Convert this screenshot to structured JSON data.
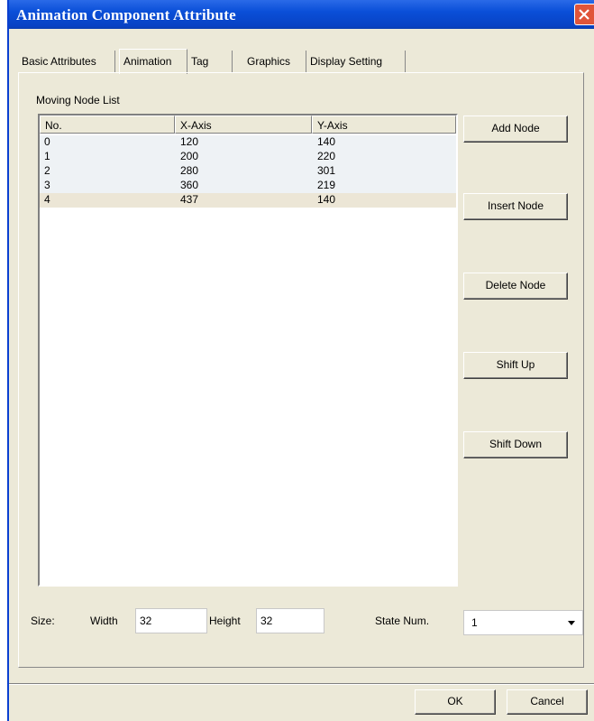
{
  "window": {
    "title": "Animation Component Attribute"
  },
  "tabs": [
    "Basic Attributes",
    "Animation",
    "Tag",
    "Graphics",
    "Display Setting"
  ],
  "active_tab": "Animation",
  "moving_node_list": {
    "label": "Moving Node List",
    "columns": [
      "No.",
      "X-Axis",
      "Y-Axis"
    ],
    "rows": [
      [
        "0",
        "120",
        "140"
      ],
      [
        "1",
        "200",
        "220"
      ],
      [
        "2",
        "280",
        "301"
      ],
      [
        "3",
        "360",
        "219"
      ],
      [
        "4",
        "437",
        "140"
      ]
    ],
    "selected_row": "4"
  },
  "buttons": {
    "add_node": "Add Node",
    "insert_node": "Insert Node",
    "delete_node": "Delete Node",
    "shift_up": "Shift Up",
    "shift_down": "Shift Down"
  },
  "size": {
    "label": "Size:",
    "width_label": "Width",
    "width_value": "32",
    "height_label": "Height",
    "height_value": "32"
  },
  "state_num": {
    "label": "State Num.",
    "value": "1"
  },
  "dialog_buttons": {
    "ok": "OK",
    "cancel": "Cancel"
  },
  "colors": {
    "titlebar": "#0a4fd8",
    "close_button": "#e0553a",
    "dialog_face": "#ece9d8"
  }
}
